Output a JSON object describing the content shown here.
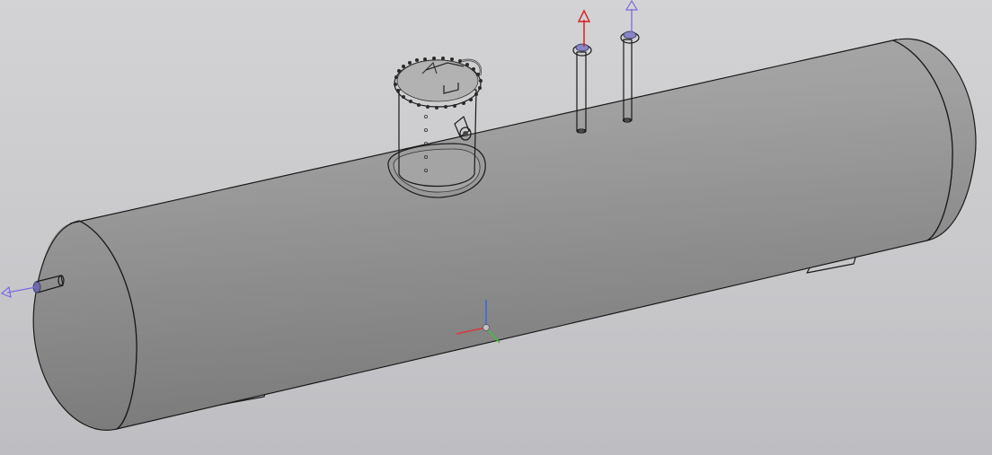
{
  "colors": {
    "background_top": "#d3d3d5",
    "background_bottom": "#bebec2",
    "body_light": "#b4b4b4",
    "body_mid": "#9a9a9a",
    "body_dark": "#7a7a7a",
    "edge": "#1a1a1a",
    "axis_x": "#d83a3a",
    "axis_y": "#3fbf3f",
    "axis_z": "#3a6ad8",
    "handle_red": "#d42020",
    "handle_violet": "#7a6ae0"
  },
  "model": {
    "name": "horizontal-tank",
    "parts": [
      "shell",
      "left-head",
      "right-head",
      "manway",
      "nozzle-left",
      "nozzle-1",
      "nozzle-2",
      "saddle-left",
      "saddle-right"
    ]
  },
  "icons": {
    "triad": "coordinate-triad-icon",
    "drag_handle": "arrow-handle-icon"
  }
}
